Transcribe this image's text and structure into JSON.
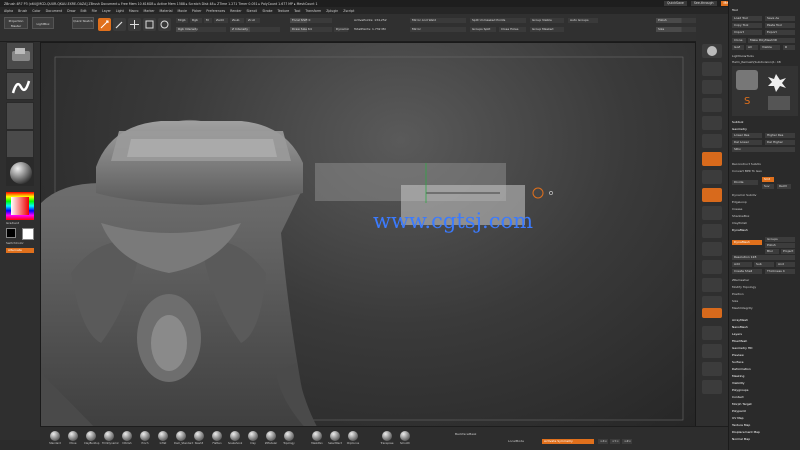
{
  "window": {
    "title": "ZBrush 4R7 P3 (x64)[MCD-QUXR-QKAU-EXRE-OAZA]   ZBrush Document   ▸ Free Mem 10.616GB ▸ Active Mem 1588 ▸ Scratch Disk 48 ▸ ZTime 1.271 Timer 0.051 ▸ PolyCount 1.677 MP ▸ MeshCount 1",
    "buttons": {
      "quicksave": "QuickSave",
      "see_through": "See-through",
      "menus": "Menus",
      "default_zscript": "DefaultZScript"
    }
  },
  "menubar": [
    "Alpha",
    "Brush",
    "Color",
    "Document",
    "Draw",
    "Edit",
    "File",
    "Layer",
    "Light",
    "Macro",
    "Marker",
    "Material",
    "Movie",
    "Picker",
    "Preferences",
    "Render",
    "Stencil",
    "Stroke",
    "Texture",
    "Tool",
    "Transform",
    "Zplugin",
    "Zscript"
  ],
  "toolshelf": {
    "projection_master": "Projection Master",
    "lightbox": "LightBox",
    "quick_sketch": "Quick Sketch",
    "edit": "Edit",
    "draw": "Draw",
    "move": "Move",
    "scale": "Scale",
    "rotate": "Rotate",
    "mrgb": "Mrgb",
    "rgb": "Rgb",
    "m": "M",
    "zadd": "Zadd",
    "zsub": "Zsub",
    "zcut": "Zcut",
    "rgb_intensity": "Rgb Intensity",
    "z_intensity": "Z Intensity",
    "focal_shift_label": "Focal Shift",
    "focal_shift_value": "0",
    "draw_size_label": "Draw Size",
    "draw_size_value": "64",
    "dynamic": "Dynamic",
    "active_points": "ActivePoints: 134,252",
    "total_points": "TotalPoints: 1.732 Mil",
    "mirror_weld": "Mirror And Weld",
    "mirror": "Mirror",
    "split_unmasked": "Split Unmasked Points",
    "groups_split": "Groups Split",
    "close_holes": "Close Holes",
    "group_visible": "Group Visible",
    "group_masked": "Group Masked",
    "auto_groups": "Auto Groups",
    "polish": "Polish",
    "size": "Size"
  },
  "tray": {
    "header": "Tool",
    "load_tool": "Load Tool",
    "save_as": "Save As",
    "copy_tool": "Copy Tool",
    "paste_tool": "Paste Tool",
    "import": "Import",
    "export": "Export",
    "clone": "Clone",
    "make_polymesh": "Make PolyMesh3D",
    "goz": "GoZ",
    "all": "All",
    "visible": "Visible",
    "r": "R",
    "lightbox_tools": "Lightbox▸Tools",
    "current_tool": "Helm_Remesh(Subdivision)1: 48",
    "subtool": "Subtool",
    "geometry": "Geometry",
    "lower_res": "Lower Res",
    "higher_res": "Higher Res",
    "del_lower": "Del Lower",
    "del_higher": "Del Higher",
    "sdiv": "SDiv",
    "reconstruct": "Reconstruct Subdiv",
    "convert_bpr": "Convert BPR To Geo",
    "divide": "Divide",
    "smt": "Smt",
    "suv": "Suv",
    "reuv": "ReUV",
    "dynamic_subdiv": "Dynamic Subdiv",
    "edgeloop": "EdgeLoop",
    "crease": "Crease",
    "shadowbox": "ShadowBox",
    "claypolish": "ClayPolish",
    "dynamesh": "DynaMesh",
    "groups": "Groups",
    "polish": "Polish",
    "blur": "Blur",
    "project": "Project",
    "resolution": "Resolution 128",
    "add": "Add",
    "sub": "Sub",
    "and": "And",
    "create_shell": "Create Shell",
    "thickness": "Thickness 4",
    "zremesher": "ZRemesher",
    "modify_topology": "Modify Topology",
    "position": "Position",
    "size": "Size",
    "meshintegrity": "MeshIntegrity",
    "arraymesh": "ArrayMesh",
    "nanomesh": "NanoMesh",
    "layers": "Layers",
    "fibermesh": "FiberMesh",
    "geometry_hd": "Geometry HD",
    "preview": "Preview",
    "surface": "Surface",
    "deformation": "Deformation",
    "masking": "Masking",
    "visibility": "Visibility",
    "polygroups": "Polygroups",
    "contact": "Contact",
    "morph_target": "Morph Target",
    "polypaint": "Polypaint",
    "uv_map": "UV Map",
    "texture_map": "Texture Map",
    "displacement_map": "Displacement Map",
    "normal_map": "Normal Map"
  },
  "leftshelf": {
    "gradient": "Gradient",
    "switch_color": "SwitchColor",
    "alternate": "Alternate"
  },
  "bottomshelf": {
    "brushes": [
      "Standard",
      "Move",
      "ClayBuildup",
      "TrimDynamic",
      "hPolish",
      "Pinch",
      "Inflat",
      "Dam_Standard",
      "Slash3",
      "Flatten",
      "Snakehook",
      "Clay",
      "ZModeler",
      "Topology"
    ],
    "extra": [
      "MaskPen",
      "SelectRect",
      "ClipCurve",
      "Transpose",
      "Smooth"
    ],
    "backface_mask": "BackfaceMask",
    "local_mode": "LocalMode",
    "activate_symmetry": "Activate Symmetry",
    "backface": "Backface",
    "x": ">X<",
    "y": ">Y<",
    "z": ">Z<",
    "dynamic": "Dynamic",
    "perspective": "Persp"
  },
  "watermark": "www.cgtsj.com",
  "colors": {
    "accent": "#e0701c",
    "panel": "#2f2f2f",
    "canvas": "#3a3a3a",
    "watermark": "#3b7bff"
  }
}
